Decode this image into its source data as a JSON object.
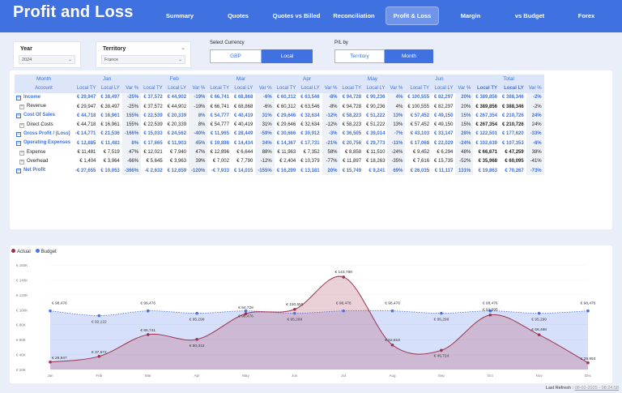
{
  "header": {
    "title": "Profit and Loss",
    "nav": [
      "Summary",
      "Quotes",
      "Quotes vs Billed",
      "Reconciliation",
      "Profit & Loss",
      "Margin",
      "vs Budget",
      "Forex"
    ],
    "active": "Profit & Loss"
  },
  "filters": {
    "year": {
      "label": "Year",
      "value": "2024"
    },
    "territory": {
      "label": "Territory",
      "value": "France"
    },
    "currency": {
      "label": "Select Currency",
      "options": [
        "GBP",
        "Local"
      ],
      "selected": "Local"
    },
    "pl_by": {
      "label": "P/L by",
      "options": [
        "Territory",
        "Month"
      ],
      "selected": "Month"
    }
  },
  "colors": {
    "accent": "#3f72e0",
    "actual": "#9b3350",
    "budget": "#4a72e6"
  },
  "table": {
    "header_month": "Month",
    "header_account": "Account",
    "months": [
      "Jan",
      "Feb",
      "Mar",
      "Apr",
      "May",
      "Jun"
    ],
    "total_label": "Total",
    "col_labels": [
      "Local TY",
      "Local LY",
      "Var %"
    ],
    "rows": [
      {
        "label": "Income",
        "type": "main",
        "v": [
          "€ 29,947",
          "€ 38,497",
          "-25%",
          "€ 37,572",
          "€ 44,902",
          "-19%",
          "€ 66,741",
          "€ 68,868",
          "-6%",
          "€ 60,312",
          "€ 63,546",
          "-8%",
          "€ 94,728",
          "€ 90,236",
          "4%",
          "€ 100,555",
          "€ 82,297",
          "20%",
          "€ 389,856",
          "€ 388,346",
          "-2%"
        ]
      },
      {
        "label": "Revenue",
        "type": "sub",
        "v": [
          "€ 29,947",
          "€ 38,497",
          "-25%",
          "€ 37,572",
          "€ 44,902",
          "-19%",
          "€ 66,741",
          "€ 68,868",
          "-6%",
          "€ 60,312",
          "€ 63,546",
          "-8%",
          "€ 94,728",
          "€ 90,236",
          "4%",
          "€ 100,555",
          "€ 82,297",
          "20%",
          "€ 389,856",
          "€ 388,346",
          "-2%"
        ]
      },
      {
        "label": "Cost Of Sales",
        "type": "main",
        "v": [
          "€ 44,718",
          "€ 16,961",
          "155%",
          "€ 22,539",
          "€ 20,339",
          "8%",
          "€ 54,777",
          "€ 40,419",
          "31%",
          "€ 29,646",
          "€ 32,634",
          "-12%",
          "€ 58,223",
          "€ 51,222",
          "13%",
          "€ 57,452",
          "€ 49,150",
          "15%",
          "€ 267,354",
          "€ 210,726",
          "24%"
        ]
      },
      {
        "label": "Direct Costs",
        "type": "sub",
        "v": [
          "€ 44,718",
          "€ 16,961",
          "155%",
          "€ 22,539",
          "€ 20,339",
          "8%",
          "€ 54,777",
          "€ 40,419",
          "31%",
          "€ 29,646",
          "€ 32,634",
          "-12%",
          "€ 58,223",
          "€ 51,222",
          "13%",
          "€ 57,452",
          "€ 49,150",
          "15%",
          "€ 267,354",
          "€ 210,726",
          "24%"
        ]
      },
      {
        "label": "Gross Profit / (Loss)",
        "type": "main",
        "v": [
          "-€ 14,771",
          "€ 21,536",
          "-166%",
          "€ 15,033",
          "€ 24,562",
          "-40%",
          "€ 11,965",
          "€ 28,449",
          "-59%",
          "€ 30,666",
          "€ 30,912",
          "-3%",
          "€ 36,505",
          "€ 39,014",
          "-7%",
          "€ 43,103",
          "€ 33,147",
          "28%",
          "€ 122,501",
          "€ 177,620",
          "-33%"
        ]
      },
      {
        "label": "Operating Expenses",
        "type": "main",
        "v": [
          "€ 12,885",
          "€ 11,483",
          "8%",
          "€ 17,665",
          "€ 11,903",
          "45%",
          "€ 19,898",
          "€ 14,434",
          "34%",
          "€ 14,367",
          "€ 17,731",
          "-21%",
          "€ 20,756",
          "€ 29,773",
          "-11%",
          "€ 17,068",
          "€ 22,029",
          "-24%",
          "€ 102,639",
          "€ 107,353",
          "-6%"
        ]
      },
      {
        "label": "Expense",
        "type": "sub",
        "v": [
          "€ 11,481",
          "€ 7,519",
          "47%",
          "€ 12,021",
          "€ 7,940",
          "47%",
          "€ 12,896",
          "€ 6,644",
          "88%",
          "€ 11,963",
          "€ 7,352",
          "58%",
          "€ 8,858",
          "€ 11,510",
          "-24%",
          "€ 9,452",
          "€ 6,294",
          "48%",
          "€ 66,671",
          "€ 47,259",
          "38%"
        ]
      },
      {
        "label": "Overhead",
        "type": "sub",
        "v": [
          "€ 1,404",
          "€ 3,964",
          "-66%",
          "€ 5,645",
          "€ 3,963",
          "39%",
          "€ 7,002",
          "€ 7,790",
          "-12%",
          "€ 2,404",
          "€ 10,379",
          "-77%",
          "€ 11,897",
          "€ 18,263",
          "-35%",
          "€ 7,616",
          "€ 15,735",
          "-52%",
          "€ 35,968",
          "€ 60,095",
          "-41%"
        ]
      },
      {
        "label": "Net Profit",
        "type": "main",
        "v": [
          "-€ 27,655",
          "€ 10,053",
          "-366%",
          "-€ 2,632",
          "€ 12,659",
          "-120%",
          "-€ 7,933",
          "€ 14,015",
          "-155%",
          "€ 16,299",
          "€ 13,181",
          "20%",
          "€ 15,749",
          "€ 9,241",
          "69%",
          "€ 26,035",
          "€ 11,117",
          "131%",
          "€ 19,863",
          "€ 70,267",
          "-73%"
        ]
      }
    ]
  },
  "chart_data": {
    "type": "area",
    "categories": [
      "Jan",
      "Feb",
      "Mar",
      "Apr",
      "May",
      "Jun",
      "Jul",
      "Aug",
      "Sep",
      "Oct",
      "Nov",
      "Dec"
    ],
    "series": [
      {
        "name": "Actual",
        "values": [
          29947,
          37572,
          66741,
          60312,
          94728,
          100555,
          143789,
          52818,
          45724,
          92995,
          66468,
          28953
        ],
        "labels": [
          "€ 29,947",
          "€ 37,572",
          "€ 66,741",
          "€ 60,312",
          "€ 94,728",
          "€ 100,555",
          "€ 143,789",
          "€ 52,818",
          "€ 45,724",
          "€ 92,995",
          "€ 66,468",
          "€ 28,953"
        ]
      },
      {
        "name": "Budget",
        "values": [
          98476,
          92122,
          98476,
          95299,
          98476,
          95299,
          98476,
          98476,
          95299,
          98476,
          95299,
          98476
        ],
        "labels": [
          "€ 98,476",
          "€ 92,122",
          "€ 98,476",
          "€ 95,299",
          "€ 98,476",
          "€ 95,299",
          "€ 98,476",
          "€ 98,476",
          "€ 95,299",
          "€ 98,476",
          "€ 95,299",
          "€ 98,476"
        ]
      }
    ],
    "yticks": [
      "€ 20K",
      "€ 40K",
      "€ 60K",
      "€ 80K",
      "€ 100K",
      "€ 120K",
      "€ 140K",
      "€ 160K"
    ],
    "ylim": [
      20000,
      160000
    ],
    "legend_position": "top-left"
  },
  "footer": {
    "refresh_label": "Last Refresh :",
    "refresh_value": "08-02-2025 - 08:24:58"
  }
}
